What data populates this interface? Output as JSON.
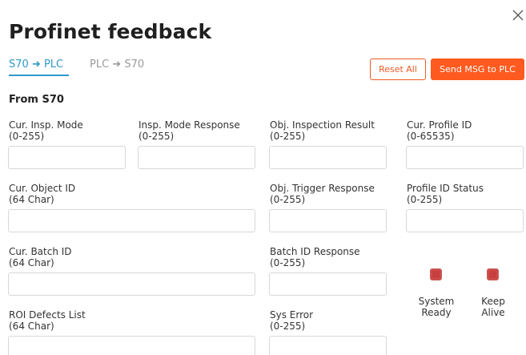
{
  "title": "Profinet feedback",
  "tabs": [
    {
      "label": "S70 ➜ PLC",
      "active": true
    },
    {
      "label": "PLC ➜ S70",
      "active": false
    }
  ],
  "buttons": {
    "reset": "Reset All",
    "send": "Send MSG to PLC"
  },
  "section": "From S70",
  "fields": {
    "cur_insp_mode": {
      "label": "Cur. Insp. Mode",
      "range": "(0-255)",
      "value": ""
    },
    "insp_mode_response": {
      "label": "Insp. Mode Response",
      "range": "(0-255)",
      "value": ""
    },
    "obj_inspection_result": {
      "label": "Obj. Inspection Result",
      "range": "(0-255)",
      "value": ""
    },
    "cur_profile_id": {
      "label": "Cur. Profile ID",
      "range": "(0-65535)",
      "value": ""
    },
    "cur_object_id": {
      "label": "Cur. Object ID",
      "range": "(64 Char)",
      "value": ""
    },
    "obj_trigger_response": {
      "label": "Obj. Trigger Response",
      "range": "(0-255)",
      "value": ""
    },
    "profile_id_status": {
      "label": "Profile ID Status",
      "range": "(0-255)",
      "value": ""
    },
    "cur_batch_id": {
      "label": "Cur. Batch ID",
      "range": "(64 Char)",
      "value": ""
    },
    "batch_id_response": {
      "label": "Batch ID Response",
      "range": "(0-255)",
      "value": ""
    },
    "roi_defects_list": {
      "label": "ROI Defects List",
      "range": "(64 Char)",
      "value": ""
    },
    "sys_error": {
      "label": "Sys Error",
      "range": "(0-255)",
      "value": ""
    }
  },
  "indicators": {
    "system_ready": {
      "line1": "System",
      "line2": "Ready"
    },
    "keep_alive": {
      "line1": "Keep",
      "line2": "Alive"
    }
  },
  "colors": {
    "accent": "#2f98c9",
    "primary_button": "#ff5a1f",
    "indicator": "#cf4a4a"
  },
  "icons": {
    "close": "close-icon"
  }
}
